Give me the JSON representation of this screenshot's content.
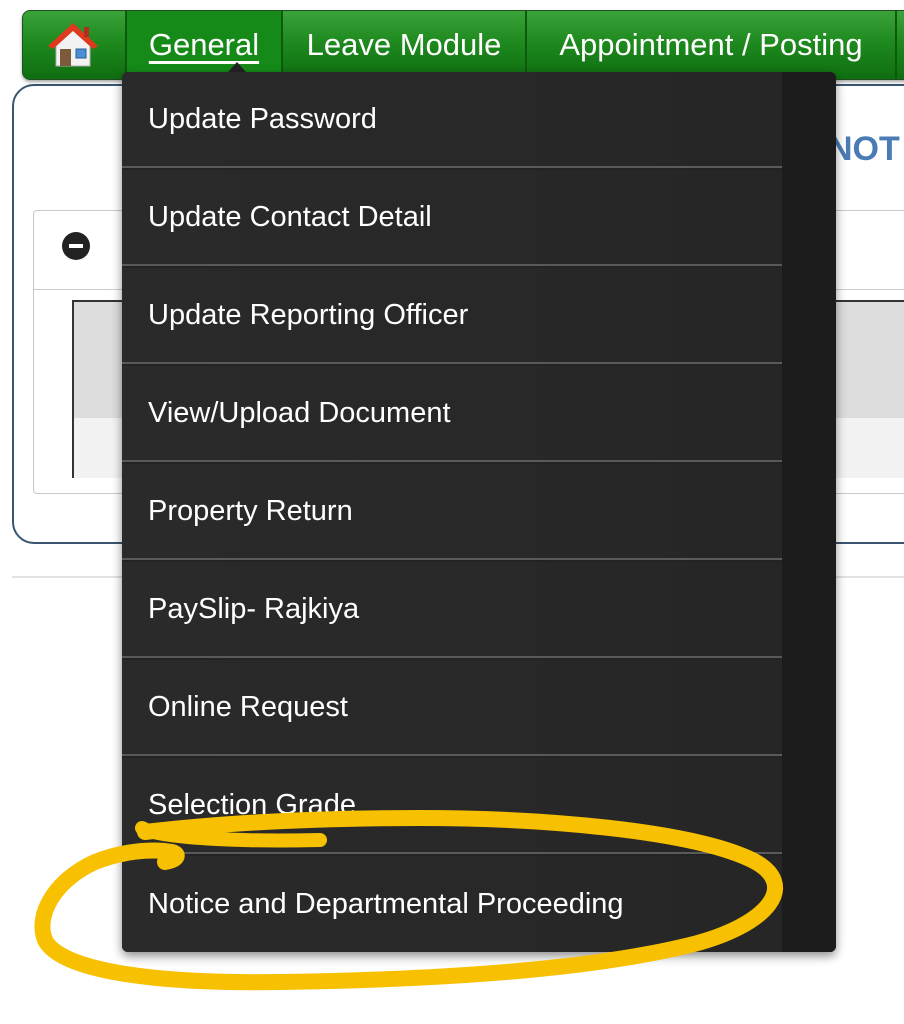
{
  "nav": {
    "home_icon": "home-icon",
    "items": [
      {
        "label": "General"
      },
      {
        "label": "Leave Module"
      },
      {
        "label": "Appointment / Posting"
      }
    ]
  },
  "page": {
    "heading_fragment": "NOT"
  },
  "panel_icon": "minus-circle-icon",
  "dropdown": {
    "items": [
      {
        "label": "Update Password"
      },
      {
        "label": "Update Contact Detail"
      },
      {
        "label": "Update Reporting Officer"
      },
      {
        "label": "View/Upload Document"
      },
      {
        "label": "Property Return"
      },
      {
        "label": "PaySlip- Rajkiya"
      },
      {
        "label": "Online Request"
      },
      {
        "label": "Selection Grade"
      },
      {
        "label": "Notice and Departmental Proceeding"
      }
    ]
  },
  "colors": {
    "nav_green": "#1f8a1f",
    "menu_bg": "#232323",
    "annotation": "#f7c000",
    "heading_blue": "#4a7bb5"
  }
}
